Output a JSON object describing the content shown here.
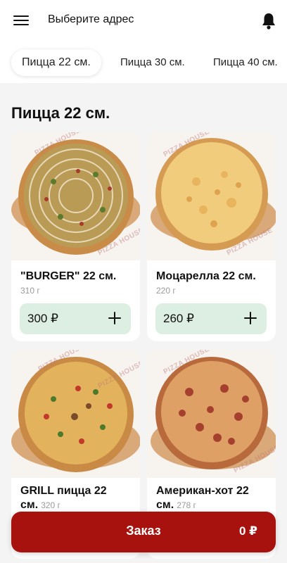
{
  "header": {
    "address_label": "Выберите адрес",
    "menu_icon": "hamburger-menu-icon",
    "notification_icon": "bell-icon"
  },
  "tabs": [
    {
      "label": "Пицца 22 см.",
      "active": true
    },
    {
      "label": "Пицца 30 см.",
      "active": false
    },
    {
      "label": "Пицца 40 см.",
      "active": false
    }
  ],
  "section": {
    "title": "Пицца 22 см."
  },
  "products": [
    {
      "name": "\"BURGER\" 22 см.",
      "weight": "310 г",
      "price": "300 ₽"
    },
    {
      "name": "Моцарелла 22 см.",
      "weight": "220 г",
      "price": "260 ₽"
    },
    {
      "name_line1": "GRILL  пицца 22",
      "name_line2": "см.",
      "weight": "320 г"
    },
    {
      "name_line1": "Американ-хот 22",
      "name_line2": "см.",
      "weight": "278 г"
    }
  ],
  "watermark": "PIZZA HOUSE",
  "order_button": {
    "label": "Заказ",
    "total": "0 ₽"
  },
  "colors": {
    "accent": "#a8120e",
    "price_button_bg": "#dcefe2",
    "background": "#f4f4f4"
  }
}
